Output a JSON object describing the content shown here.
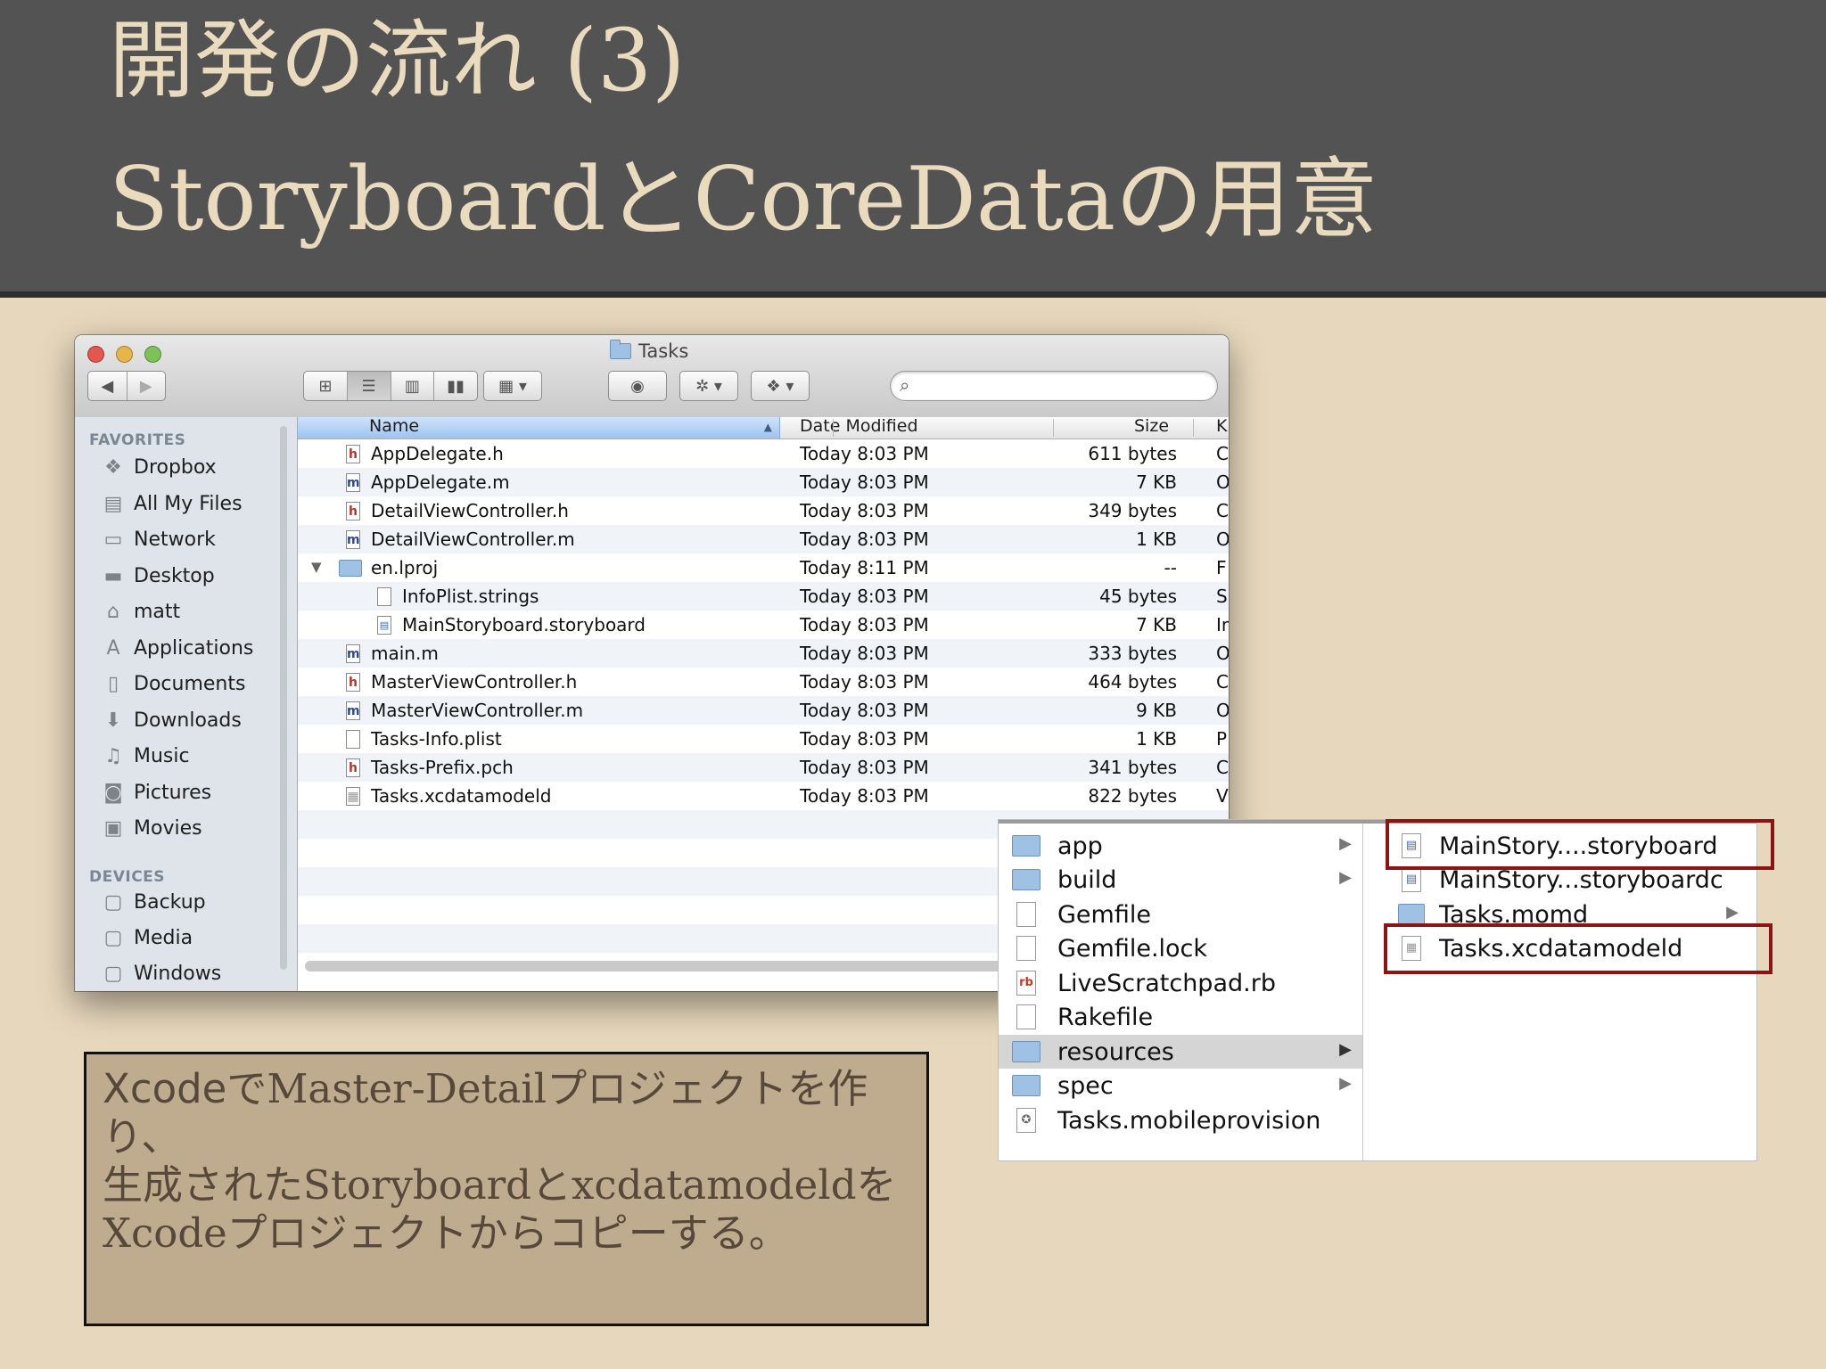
{
  "slide": {
    "title_line1": "開発の流れ (3)",
    "title_line2": "StoryboardとCoreDataの用意",
    "caption_line1_word": "Xcode",
    "caption_line1_rest": "でMaster-Detailプロジェクトを作り、",
    "caption_line2": "生成されたStoryboardとxcdatamodeldを",
    "caption_line3": "Xcodeプロジェクトからコピーする。"
  },
  "finder": {
    "window_title": "Tasks",
    "search_placeholder": "",
    "sidebar": {
      "favorites_header": "FAVORITES",
      "favorites": [
        {
          "label": "Dropbox",
          "icon": "dropbox-icon"
        },
        {
          "label": "All My Files",
          "icon": "all-files-icon"
        },
        {
          "label": "Network",
          "icon": "network-icon"
        },
        {
          "label": "Desktop",
          "icon": "desktop-icon"
        },
        {
          "label": "matt",
          "icon": "home-icon"
        },
        {
          "label": "Applications",
          "icon": "applications-icon"
        },
        {
          "label": "Documents",
          "icon": "documents-icon"
        },
        {
          "label": "Downloads",
          "icon": "downloads-icon"
        },
        {
          "label": "Music",
          "icon": "music-icon"
        },
        {
          "label": "Pictures",
          "icon": "pictures-icon"
        },
        {
          "label": "Movies",
          "icon": "movies-icon"
        }
      ],
      "devices_header": "DEVICES",
      "devices": [
        {
          "label": "Backup",
          "icon": "disk-icon"
        },
        {
          "label": "Media",
          "icon": "disk-icon"
        },
        {
          "label": "Windows",
          "icon": "disk-icon"
        }
      ]
    },
    "columns": {
      "name": "Name",
      "date": "Date Modified",
      "size": "Size",
      "kind": "K"
    },
    "files": [
      {
        "name": "AppDelegate.h",
        "date": "Today 8:03 PM",
        "size": "611 bytes",
        "kind": "C",
        "icon": "h"
      },
      {
        "name": "AppDelegate.m",
        "date": "Today 8:03 PM",
        "size": "7 KB",
        "kind": "O",
        "icon": "m"
      },
      {
        "name": "DetailViewController.h",
        "date": "Today 8:03 PM",
        "size": "349 bytes",
        "kind": "C",
        "icon": "h"
      },
      {
        "name": "DetailViewController.m",
        "date": "Today 8:03 PM",
        "size": "1 KB",
        "kind": "O",
        "icon": "m"
      },
      {
        "name": "en.lproj",
        "date": "Today 8:11 PM",
        "size": "--",
        "kind": "F",
        "icon": "folder"
      },
      {
        "name": "InfoPlist.strings",
        "date": "Today 8:03 PM",
        "size": "45 bytes",
        "kind": "S",
        "icon": "doc"
      },
      {
        "name": "MainStoryboard.storyboard",
        "date": "Today 8:03 PM",
        "size": "7 KB",
        "kind": "Ir",
        "icon": "storyboard"
      },
      {
        "name": "main.m",
        "date": "Today 8:03 PM",
        "size": "333 bytes",
        "kind": "O",
        "icon": "m"
      },
      {
        "name": "MasterViewController.h",
        "date": "Today 8:03 PM",
        "size": "464 bytes",
        "kind": "C",
        "icon": "h"
      },
      {
        "name": "MasterViewController.m",
        "date": "Today 8:03 PM",
        "size": "9 KB",
        "kind": "O",
        "icon": "m"
      },
      {
        "name": "Tasks-Info.plist",
        "date": "Today 8:03 PM",
        "size": "1 KB",
        "kind": "P",
        "icon": "doc"
      },
      {
        "name": "Tasks-Prefix.pch",
        "date": "Today 8:03 PM",
        "size": "341 bytes",
        "kind": "C",
        "icon": "h"
      },
      {
        "name": "Tasks.xcdatamodeld",
        "date": "Today 8:03 PM",
        "size": "822 bytes",
        "kind": "V",
        "icon": "doc"
      }
    ]
  },
  "browser": {
    "column1": [
      {
        "label": "app",
        "icon": "folder-icon",
        "has_children": true
      },
      {
        "label": "build",
        "icon": "folder-icon",
        "has_children": true
      },
      {
        "label": "Gemfile",
        "icon": "document-icon",
        "has_children": false
      },
      {
        "label": "Gemfile.lock",
        "icon": "document-icon",
        "has_children": false
      },
      {
        "label": "LiveScratchpad.rb",
        "icon": "ruby-file-icon",
        "has_children": false
      },
      {
        "label": "Rakefile",
        "icon": "document-icon",
        "has_children": false
      },
      {
        "label": "resources",
        "icon": "folder-icon",
        "has_children": true
      },
      {
        "label": "spec",
        "icon": "folder-icon",
        "has_children": true
      },
      {
        "label": "Tasks.mobileprovision",
        "icon": "certificate-icon",
        "has_children": false
      }
    ],
    "column2": [
      {
        "label": "MainStory....storyboard",
        "icon": "storyboard-file-icon",
        "has_children": false
      },
      {
        "label": "MainStory...storyboardc",
        "icon": "storyboard-file-icon",
        "has_children": false
      },
      {
        "label": "Tasks.momd",
        "icon": "folder-icon",
        "has_children": true
      },
      {
        "label": "Tasks.xcdatamodeld",
        "icon": "data-model-icon",
        "has_children": false
      }
    ],
    "rb_badge": "rb"
  }
}
